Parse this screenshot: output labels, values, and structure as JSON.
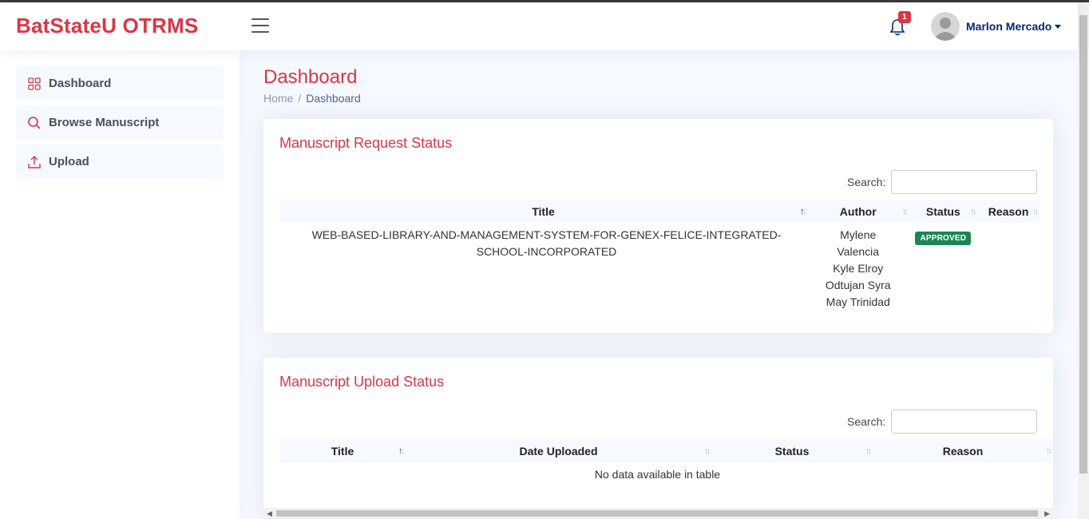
{
  "app": {
    "brand": "BatStateU OTRMS"
  },
  "header": {
    "notification_count": "1",
    "user_name": "Marlon Mercado",
    "menu_icon": "hamburger-icon",
    "bell_icon": "bell-icon"
  },
  "sidebar": {
    "items": [
      {
        "label": "Dashboard",
        "icon": "grid-icon"
      },
      {
        "label": "Browse Manuscript",
        "icon": "search-icon"
      },
      {
        "label": "Upload",
        "icon": "upload-icon"
      }
    ]
  },
  "page": {
    "title": "Dashboard",
    "breadcrumb": [
      "Home",
      "Dashboard"
    ]
  },
  "request_card": {
    "title": "Manuscript Request Status",
    "search_label": "Search:",
    "search_value": "",
    "columns": [
      "Title",
      "Author",
      "Status",
      "Reason"
    ],
    "rows": [
      {
        "title": "WEB-BASED-LIBRARY-AND-MANAGEMENT-SYSTEM-FOR-GENEX-FELICE-INTEGRATED-SCHOOL-INCORPORATED",
        "author": "Mylene Valencia Kyle Elroy Odtujan Syra May Trinidad",
        "status": "APPROVED",
        "reason": ""
      }
    ]
  },
  "upload_card": {
    "title": "Manuscript Upload Status",
    "search_label": "Search:",
    "search_value": "",
    "columns": [
      "Title",
      "Date Uploaded",
      "Status",
      "Reason"
    ],
    "empty_message": "No data available in table"
  },
  "colors": {
    "brand": "#dc3545",
    "approved": "#198754",
    "navy": "#012970"
  }
}
